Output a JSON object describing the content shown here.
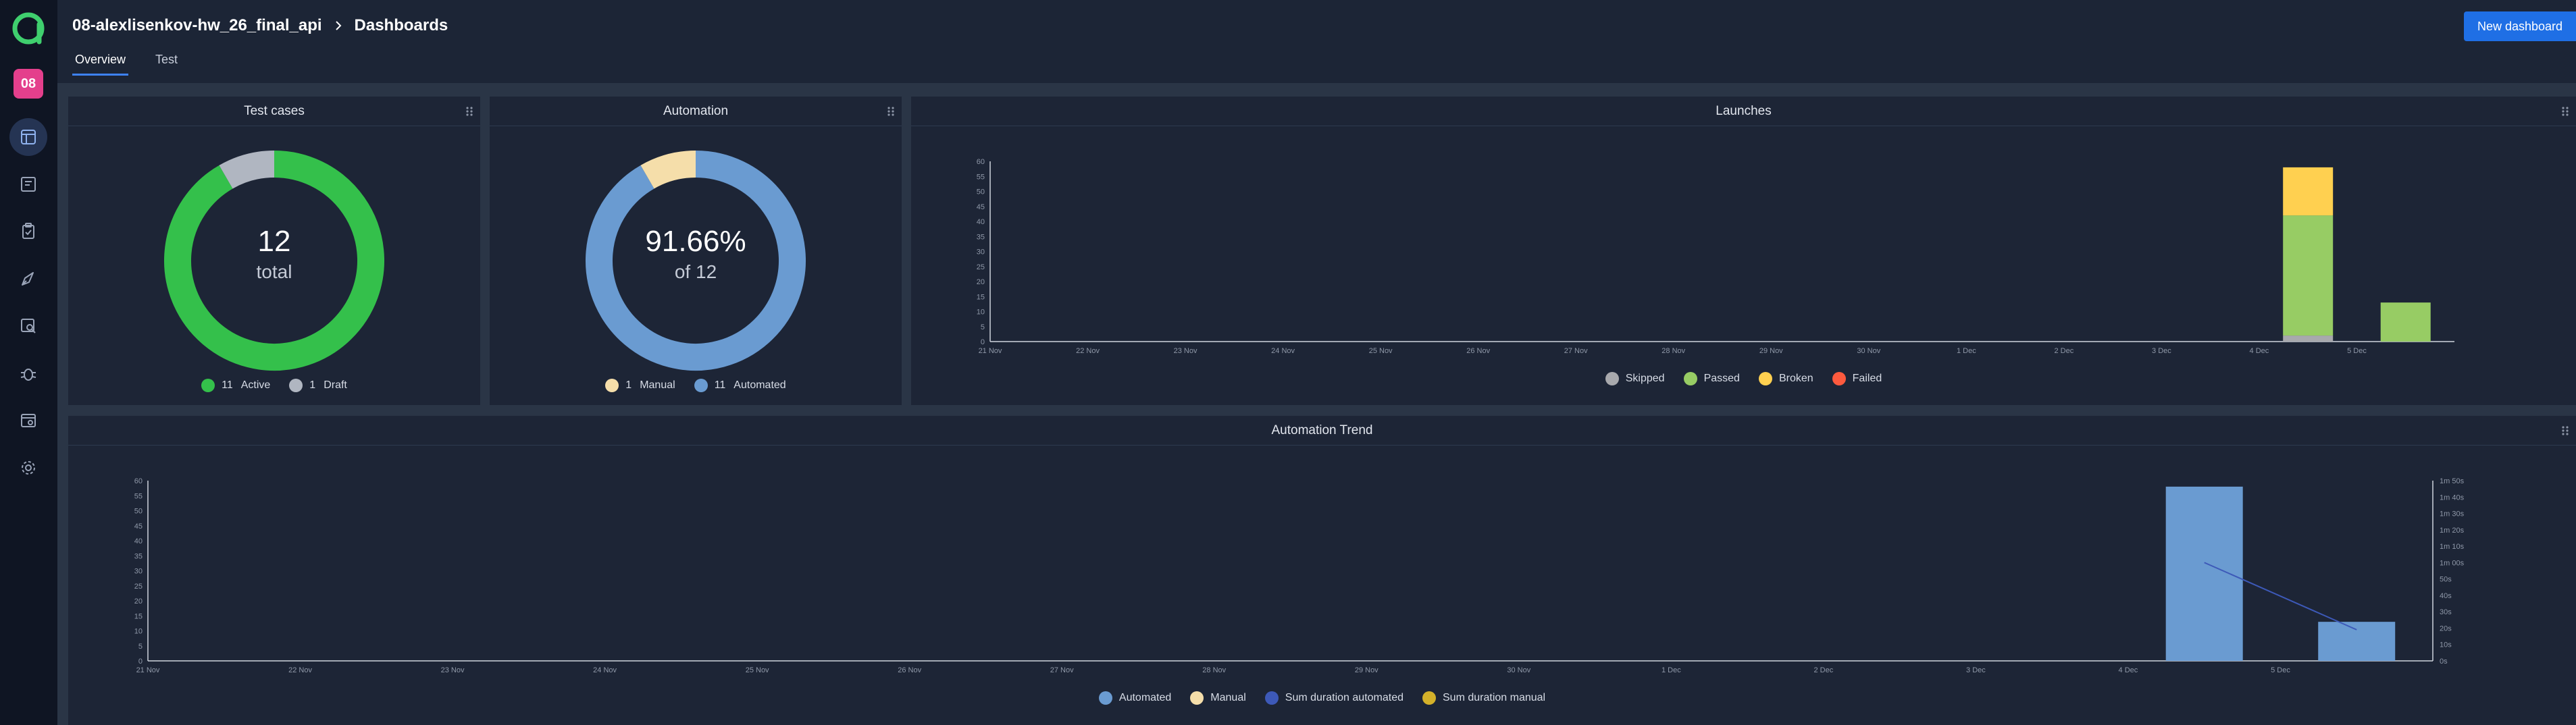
{
  "header": {
    "project": "08-alexlisenkov-hw_26_final_api",
    "page": "Dashboards",
    "tabs": [
      "Overview",
      "Test"
    ],
    "new_dashboard": "New dashboard"
  },
  "sidebar": {
    "project_badge": "08",
    "items": [
      "dashboards-icon",
      "test-cases-icon",
      "test-plans-icon",
      "launches-icon",
      "analytics-icon",
      "defects-icon",
      "jobs-icon",
      "settings-icon"
    ]
  },
  "colors": {
    "accent": "#1f6fe5",
    "active": "#34c04b",
    "draft": "#b0b6c1",
    "automated": "#6a9bd1",
    "manual": "#f5deaa",
    "skipped": "#a8a9ad",
    "passed": "#97cc64",
    "broken": "#ffd050",
    "failed": "#fd5a3e",
    "sum_automated": "#3d59b8",
    "sum_manual": "#d4b12a"
  },
  "test_cases": {
    "title": "Test cases",
    "total": "12",
    "total_label": "total",
    "legend": [
      {
        "count": "11",
        "label": "Active"
      },
      {
        "count": "1",
        "label": "Draft"
      }
    ]
  },
  "automation": {
    "title": "Automation",
    "percent": "91.66%",
    "of_label": "of 12",
    "legend": [
      {
        "count": "1",
        "label": "Manual"
      },
      {
        "count": "11",
        "label": "Automated"
      }
    ]
  },
  "chart_data": [
    {
      "type": "pie",
      "title": "Test cases",
      "categories": [
        "Active",
        "Draft"
      ],
      "values": [
        11,
        1
      ]
    },
    {
      "type": "pie",
      "title": "Automation",
      "categories": [
        "Automated",
        "Manual"
      ],
      "values": [
        11,
        1
      ]
    },
    {
      "type": "bar",
      "title": "Launches",
      "stacked": true,
      "categories": [
        "21 Nov",
        "22 Nov",
        "23 Nov",
        "24 Nov",
        "25 Nov",
        "26 Nov",
        "27 Nov",
        "28 Nov",
        "29 Nov",
        "30 Nov",
        "1 Dec",
        "2 Dec",
        "3 Dec",
        "4 Dec",
        "5 Dec"
      ],
      "bar_positions": [
        13.5,
        14.5
      ],
      "series": [
        {
          "name": "Skipped",
          "values": [
            2,
            0
          ]
        },
        {
          "name": "Passed",
          "values": [
            40,
            13
          ]
        },
        {
          "name": "Broken",
          "values": [
            16,
            0
          ]
        },
        {
          "name": "Failed",
          "values": [
            0,
            0
          ]
        }
      ],
      "yticks": [
        0,
        5,
        10,
        15,
        20,
        25,
        30,
        35,
        40,
        45,
        50,
        55,
        60
      ],
      "ylim": [
        0,
        60
      ],
      "legend": "bottom"
    },
    {
      "type": "bar",
      "title": "Automation Trend",
      "categories": [
        "21 Nov",
        "22 Nov",
        "23 Nov",
        "24 Nov",
        "25 Nov",
        "26 Nov",
        "27 Nov",
        "28 Nov",
        "29 Nov",
        "30 Nov",
        "1 Dec",
        "2 Dec",
        "3 Dec",
        "4 Dec",
        "5 Dec"
      ],
      "bar_positions": [
        13.5,
        14.5
      ],
      "series": [
        {
          "name": "Automated",
          "values": [
            58,
            13
          ]
        },
        {
          "name": "Manual",
          "values": [
            0,
            0
          ]
        }
      ],
      "line_series": [
        {
          "name": "Sum duration automated",
          "axis": "right",
          "x": [
            13.5,
            14.5
          ],
          "values": [
            60,
            19
          ]
        },
        {
          "name": "Sum duration manual",
          "axis": "right",
          "x": [],
          "values": []
        }
      ],
      "yticks": [
        0,
        5,
        10,
        15,
        20,
        25,
        30,
        35,
        40,
        45,
        50,
        55,
        60
      ],
      "ylim": [
        0,
        60
      ],
      "y2ticks": [
        "0s",
        "10s",
        "20s",
        "30s",
        "40s",
        "50s",
        "1m 00s",
        "1m 10s",
        "1m 20s",
        "1m 30s",
        "1m 40s",
        "1m 50s"
      ],
      "y2lim": [
        0,
        110
      ],
      "legend": "bottom"
    }
  ]
}
